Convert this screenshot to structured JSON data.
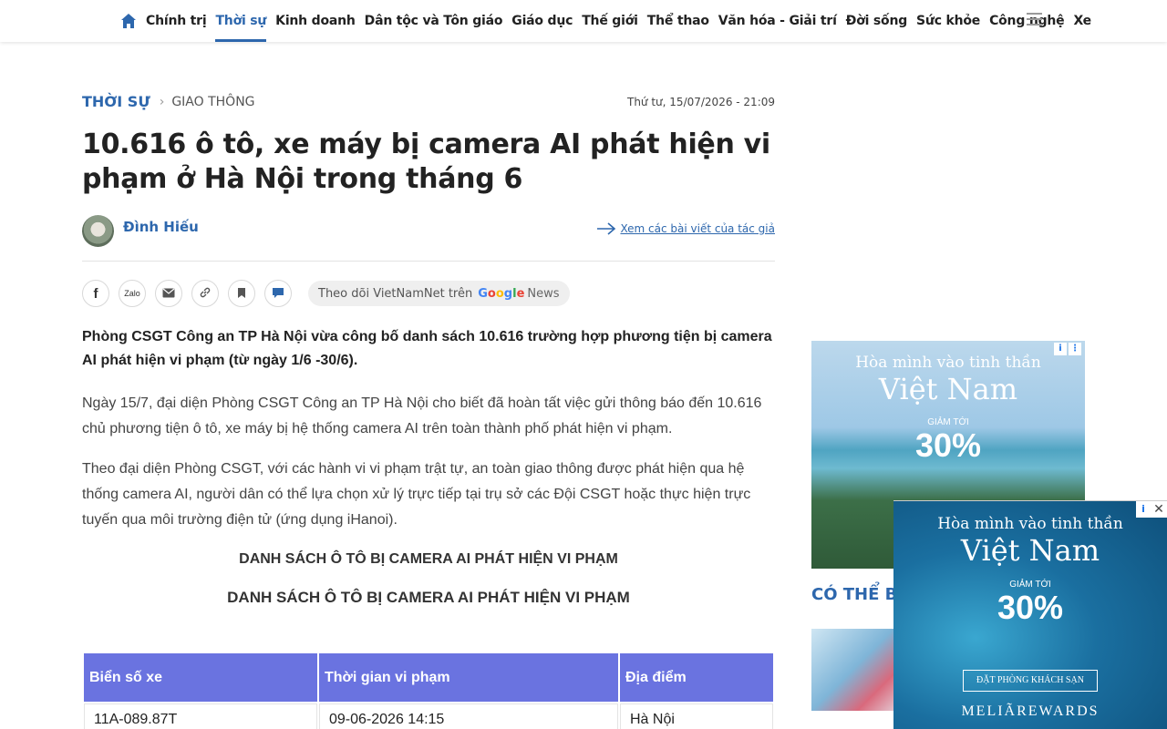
{
  "nav": {
    "items": [
      {
        "label": "Chính trị"
      },
      {
        "label": "Thời sự",
        "active": true
      },
      {
        "label": "Kinh doanh"
      },
      {
        "label": "Dân tộc và Tôn giáo"
      },
      {
        "label": "Giáo dục"
      },
      {
        "label": "Thế giới"
      },
      {
        "label": "Thể thao"
      },
      {
        "label": "Văn hóa - Giải trí"
      },
      {
        "label": "Đời sống"
      },
      {
        "label": "Sức khỏe"
      },
      {
        "label": "Công nghệ"
      },
      {
        "label": "Xe"
      }
    ],
    "icons": {
      "home": "home-icon",
      "menu": "hamburger-menu-icon"
    },
    "accent_color": "#2d67ad"
  },
  "breadcrumb": {
    "category": "THỜI SỰ",
    "subcategory": "GIAO THÔNG"
  },
  "article": {
    "date": "Thứ tư, 15/07/2026 - 21:09",
    "title": "10.616 ô tô, xe máy bị camera AI phát hiện vi phạm ở Hà Nội trong tháng 6",
    "author": "Đình Hiếu",
    "author_link": "Xem các bài viết của tác giả",
    "follow_text": "Theo dõi VietNamNet trên",
    "follow_brand": "Google",
    "follow_brand_suffix": "News",
    "share_buttons": [
      {
        "icon": "facebook-icon",
        "label": "f"
      },
      {
        "icon": "zalo-icon",
        "label": "Zalo"
      },
      {
        "icon": "email-icon",
        "label": "✉"
      },
      {
        "icon": "link-icon",
        "label": "🔗"
      },
      {
        "icon": "bookmark-icon",
        "label": "🔖"
      },
      {
        "icon": "comment-icon",
        "label": "💬"
      }
    ],
    "sapo": "Phòng CSGT Công an TP Hà Nội vừa công bố danh sách 10.616 trường hợp phương tiện bị camera AI phát hiện vi phạm (từ ngày 1/6 -30/6).",
    "paragraphs": [
      "Ngày 15/7, đại diện Phòng CSGT Công an TP Hà Nội cho biết đã hoàn tất việc gửi thông báo đến 10.616 chủ phương tiện ô tô, xe máy bị hệ thống camera AI trên toàn thành phố phát hiện vi phạm.",
      "Theo đại diện Phòng CSGT, với các hành vi vi phạm trật tự, an toàn giao thông được phát hiện qua hệ thống camera AI, người dân có thể lựa chọn xử lý trực tiếp tại trụ sở các Đội CSGT hoặc thực hiện trực tuyến qua môi trường điện tử (ứng dụng iHanoi)."
    ],
    "list_title_1": "DANH SÁCH Ô TÔ BỊ CAMERA AI PHÁT HIỆN VI PHẠM",
    "list_title_2": "DANH SÁCH Ô TÔ BỊ CAMERA AI PHÁT HIỆN VI PHẠM",
    "table": {
      "headers": [
        "Biển số xe",
        "Thời gian vi phạm",
        "Địa điểm"
      ],
      "rows": [
        [
          "11A-089.87T",
          "09-06-2026 14:15",
          "Hà Nội"
        ]
      ],
      "header_color": "#6a73e0"
    }
  },
  "sidebar": {
    "related_title": "CÓ THỂ BẠ"
  },
  "ads": {
    "ad1": {
      "line1": "Hòa mình vào tinh thần",
      "line2": "Việt Nam",
      "discount_label": "GIẢM TỚI",
      "discount": "30%"
    },
    "ad2": {
      "line1": "Hòa mình vào tinh thần",
      "line2": "Việt Nam",
      "discount_label": "GIẢM TỚI",
      "discount": "30%",
      "cta": "ĐẶT PHÒNG KHÁCH SẠN",
      "brand": "MELIÃREWARDS",
      "close": "✕",
      "info": "i"
    }
  }
}
